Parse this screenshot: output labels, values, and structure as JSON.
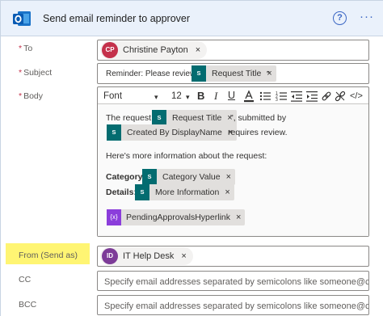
{
  "header": {
    "title": "Send email reminder to approver",
    "help_icon": "question-circle-icon",
    "more_icon": "ellipsis-icon",
    "more_glyph": "···",
    "help_glyph": "?"
  },
  "to": {
    "label": "To",
    "required_mark": "*",
    "recipient": {
      "initials": "CP",
      "name": "Christine Payton",
      "avatar_color": "#c4314b"
    }
  },
  "subject": {
    "label": "Subject",
    "required_mark": "*",
    "prefix": "Reminder: Please review \"",
    "token": "Request Title",
    "suffix": "\""
  },
  "body": {
    "label": "Body",
    "required_mark": "*",
    "toolbar": {
      "font": "Font",
      "font_size": "12",
      "bold": "B",
      "italic": "I",
      "underline": "U",
      "code_view": "</>"
    },
    "line1_prefix": "The request \"",
    "line1_token": "Request Title",
    "line1_suffix": "\", submitted by",
    "line2_token": "Created By DisplayName",
    "line2_suffix": "requires review.",
    "info_text": "Here's more information about the request:",
    "category_label": "Category",
    "category_token": "Category Value",
    "details_label": "Details",
    "details_token": "More Information",
    "link_token": "PendingApprovalsHyperlink",
    "close_glyph": "×",
    "sp_glyph": "S",
    "fx_glyph": "{x}"
  },
  "from": {
    "label": "From (Send as)",
    "sender": {
      "initials": "ID",
      "name": "IT Help Desk",
      "avatar_color": "#7d3c98"
    }
  },
  "cc": {
    "label": "CC",
    "placeholder": "Specify email addresses separated by semicolons like someone@co"
  },
  "bcc": {
    "label": "BCC",
    "placeholder": "Specify email addresses separated by semicolons like someone@co"
  },
  "colors": {
    "accent": "#3a66c4",
    "sharepoint": "#036c70",
    "expression": "#8b3ddb",
    "highlight": "#fff573"
  }
}
